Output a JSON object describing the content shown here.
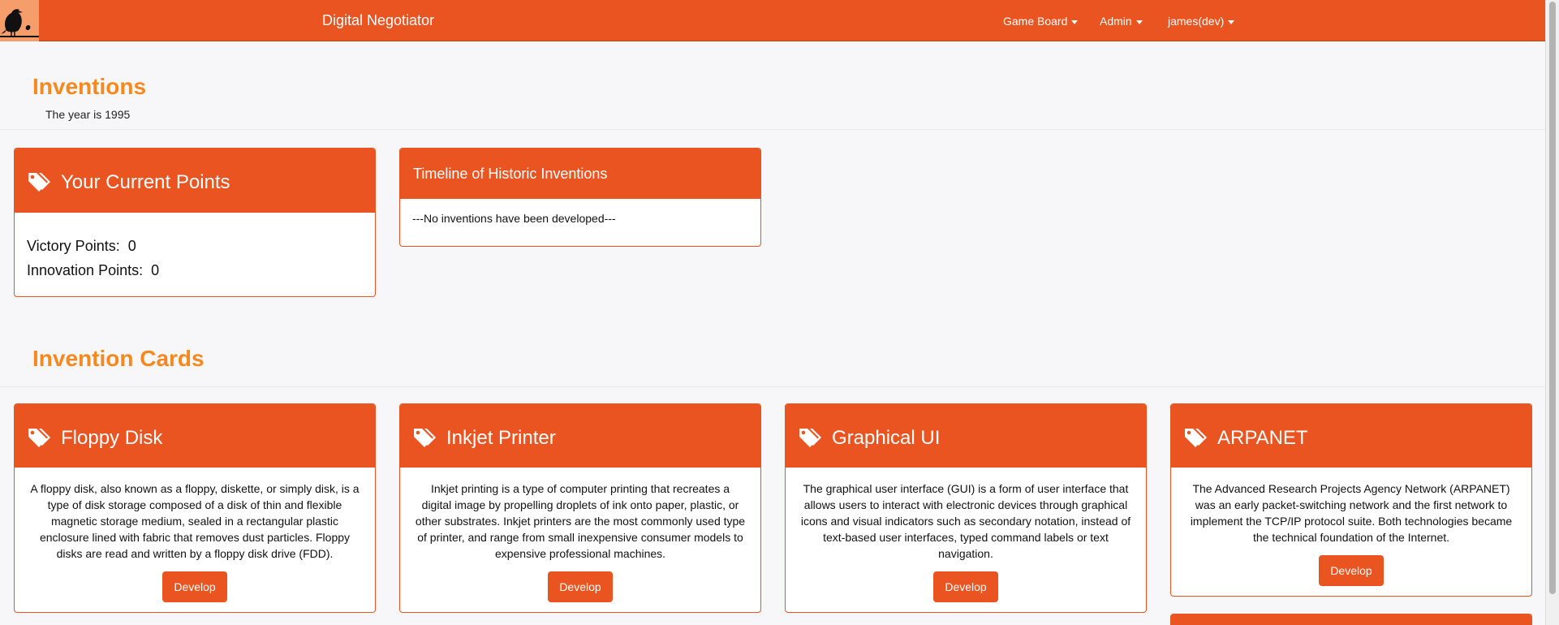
{
  "navbar": {
    "brand": "Digital Negotiator",
    "menus": [
      "Game Board",
      "Admin",
      "james(dev)"
    ]
  },
  "page": {
    "title": "Inventions",
    "year_text": "The year is 1995",
    "cards_title": "Invention Cards"
  },
  "points_panel": {
    "title": "Your Current Points",
    "victory_label": "Victory Points:",
    "victory_value": "0",
    "innovation_label": "Innovation Points:",
    "innovation_value": "0"
  },
  "timeline_panel": {
    "title": "Timeline of Historic Inventions",
    "empty_text": "---No inventions have been developed---"
  },
  "cards": [
    {
      "title": "Floppy Disk",
      "description": "A floppy disk, also known as a floppy, diskette, or simply disk, is a type of disk storage composed of a disk of thin and flexible magnetic storage medium, sealed in a rectangular plastic enclosure lined with fabric that removes dust particles. Floppy disks are read and written by a floppy disk drive (FDD).",
      "button": "Develop"
    },
    {
      "title": "Inkjet Printer",
      "description": "Inkjet printing is a type of computer printing that recreates a digital image by propelling droplets of ink onto paper, plastic, or other substrates. Inkjet printers are the most commonly used type of printer, and range from small inexpensive consumer models to expensive professional machines.",
      "button": "Develop"
    },
    {
      "title": "Graphical UI",
      "description": "The graphical user interface (GUI) is a form of user interface that allows users to interact with electronic devices through graphical icons and visual indicators such as secondary notation, instead of text-based user interfaces, typed command labels or text navigation.",
      "button": "Develop"
    },
    {
      "title": "ARPANET",
      "description": "The Advanced Research Projects Agency Network (ARPANET) was an early packet-switching network and the first network to implement the TCP/IP protocol suite. Both technologies became the technical foundation of the Internet.",
      "button": "Develop"
    }
  ],
  "colors": {
    "primary": "#e95420",
    "heading": "#f5891f",
    "background": "#f7f7f9"
  },
  "icons": {
    "logo": "bird-logo-icon",
    "panel": "tags-icon",
    "menu": "caret-down-icon"
  }
}
